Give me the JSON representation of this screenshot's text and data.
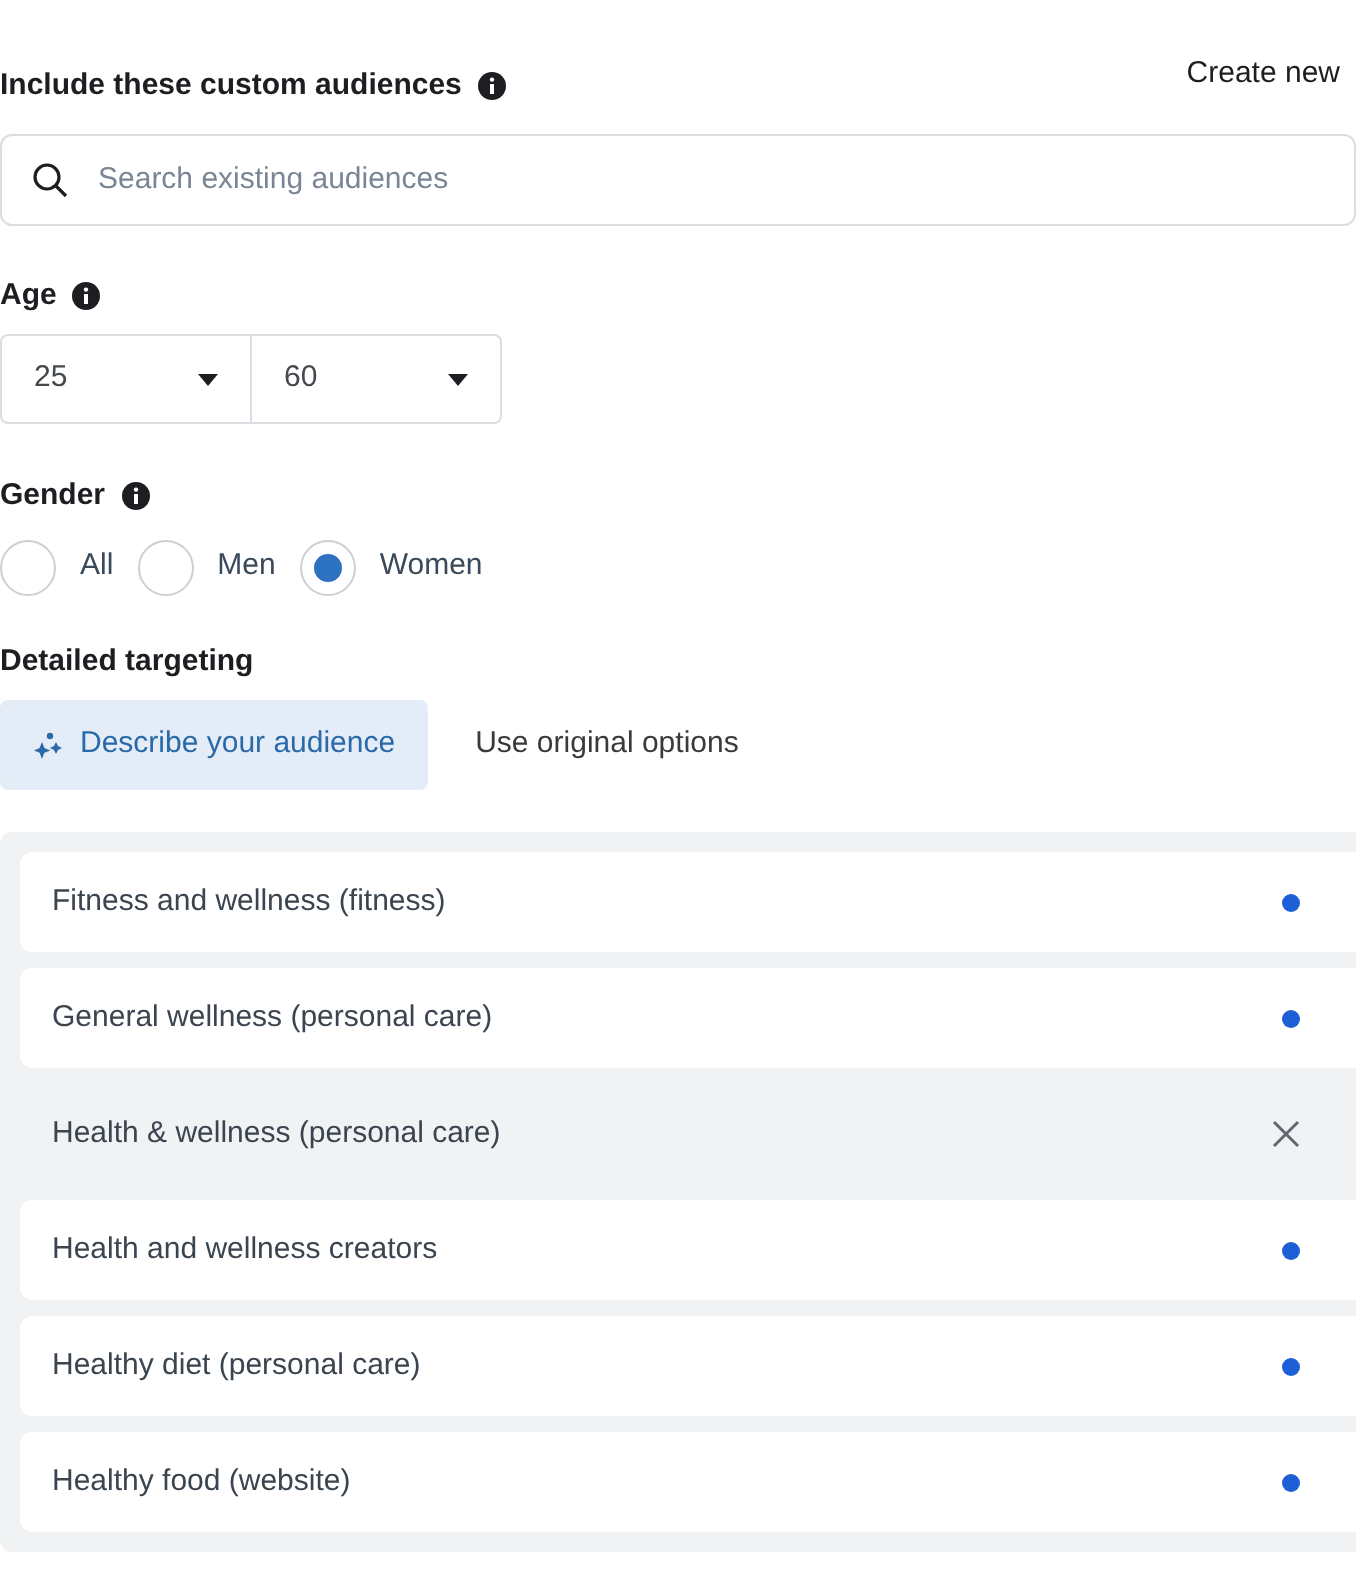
{
  "custom_audiences": {
    "label": "Include these custom audiences",
    "create_link": "Create new",
    "search": {
      "placeholder": "Search existing audiences"
    }
  },
  "age": {
    "label": "Age",
    "min": "25",
    "max": "60"
  },
  "gender": {
    "label": "Gender",
    "options": [
      {
        "label": "All",
        "selected": false
      },
      {
        "label": "Men",
        "selected": false
      },
      {
        "label": "Women",
        "selected": true
      }
    ]
  },
  "detailed_targeting": {
    "label": "Detailed targeting",
    "tabs": [
      {
        "label": "Describe your audience",
        "selected": true
      },
      {
        "label": "Use original options",
        "selected": false
      }
    ],
    "items": [
      {
        "label": "Fitness and wellness (fitness)",
        "hovered": false
      },
      {
        "label": "General wellness (personal care)",
        "hovered": false
      },
      {
        "label": "Health & wellness (personal care)",
        "hovered": true
      },
      {
        "label": "Health and wellness creators",
        "hovered": false
      },
      {
        "label": "Healthy diet (personal care)",
        "hovered": false
      },
      {
        "label": "Healthy food (website)",
        "hovered": false
      }
    ]
  }
}
